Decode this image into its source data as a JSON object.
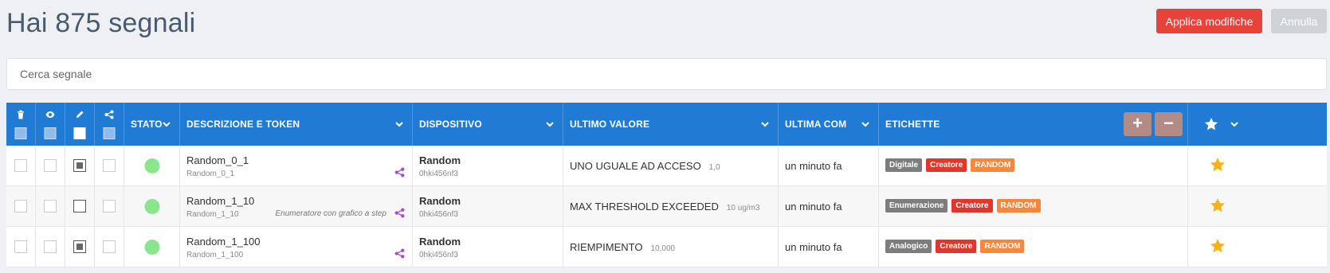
{
  "header": {
    "title": "Hai 875 segnali",
    "apply_label": "Applica modifiche",
    "cancel_label": "Annulla"
  },
  "search": {
    "placeholder": "Cerca segnale"
  },
  "table": {
    "columns": {
      "stato": "STATO",
      "descrizione": "DESCRIZIONE E TOKEN",
      "dispositivo": "DISPOSITIVO",
      "ultimo_valore": "ULTIMO VALORE",
      "ultima_com": "ULTIMA COM",
      "etichette": "ETICHETTE"
    },
    "header_icons": [
      "trash-icon",
      "eye-icon",
      "pencil-icon",
      "share-icon"
    ],
    "add_label": "+",
    "remove_label": "−",
    "rows": [
      {
        "name": "Random_0_1",
        "token": "Random_0_1",
        "hint": "",
        "device": "Random",
        "device_id": "0hki456nf3",
        "value": "UNO UGUALE AD ACCESO",
        "value_unit": "1,0",
        "last_com": "un minuto fa",
        "edit_checked": true,
        "tags": [
          {
            "label": "Digitale",
            "color": "#7d7d7d"
          },
          {
            "label": "Creatore",
            "color": "#e0362c"
          },
          {
            "label": "RANDOM",
            "color": "#f7873c"
          }
        ]
      },
      {
        "name": "Random_1_10",
        "token": "Random_1_10",
        "hint": "Enumeratore con grafico a step",
        "device": "Random",
        "device_id": "0hki456nf3",
        "value": "MAX THRESHOLD EXCEEDED",
        "value_unit": "10 ug/m3",
        "last_com": "un minuto fa",
        "edit_checked": false,
        "tags": [
          {
            "label": "Enumerazione",
            "color": "#7d7d7d"
          },
          {
            "label": "Creatore",
            "color": "#e0362c"
          },
          {
            "label": "RANDOM",
            "color": "#f7873c"
          }
        ]
      },
      {
        "name": "Random_1_100",
        "token": "Random_1_100",
        "hint": "",
        "device": "Random",
        "device_id": "0hki456nf3",
        "value": "RIEMPIMENTO",
        "value_unit": "10,000",
        "last_com": "un minuto fa",
        "edit_checked": true,
        "tags": [
          {
            "label": "Analogico",
            "color": "#7d7d7d"
          },
          {
            "label": "Creatore",
            "color": "#e0362c"
          },
          {
            "label": "RANDOM",
            "color": "#f7873c"
          }
        ]
      }
    ]
  },
  "colors": {
    "header_blue": "#1f7bd4",
    "apply_red": "#e8433b",
    "status_green": "#8ae68c",
    "star_gold": "#f5b21c",
    "share_purple": "#a64fc4"
  }
}
